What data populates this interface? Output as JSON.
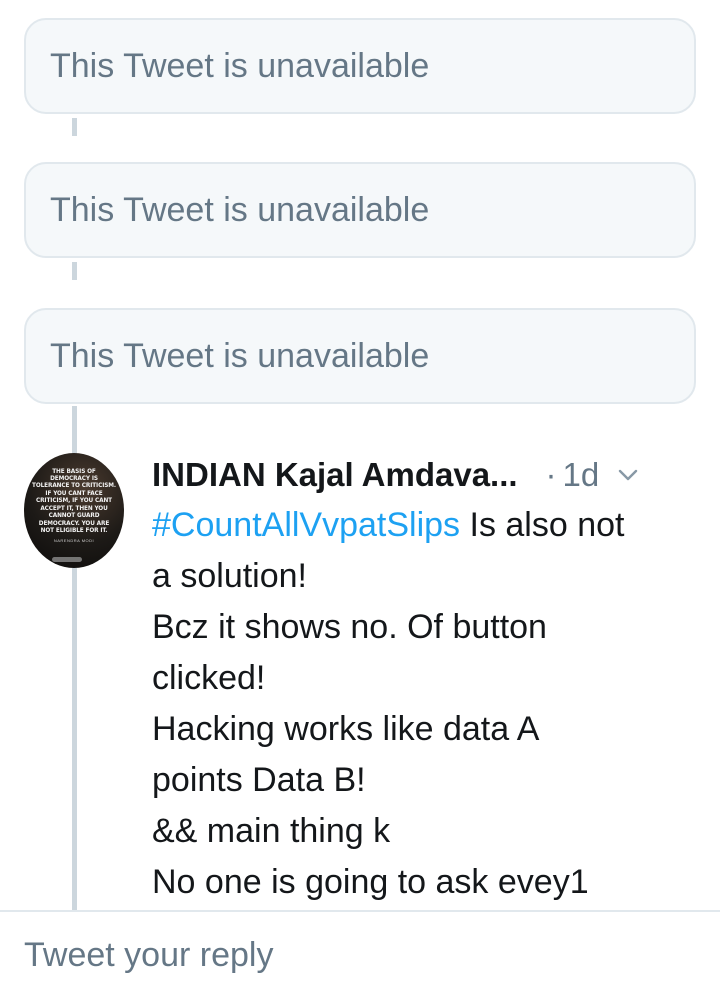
{
  "thread": {
    "unavailable_cards": [
      {
        "text": "This Tweet is unavailable"
      },
      {
        "text": "This Tweet is unavailable"
      },
      {
        "text": "This Tweet is unavailable"
      }
    ]
  },
  "tweet": {
    "author_name": "INDIAN Kajal Amdava...",
    "separator": "·",
    "time_ago": "1d",
    "avatar": {
      "quote": "THE BASIS OF DEMOCRACY IS TOLERANCE TO CRITICISM. IF YOU CANT FACE CRITICISM, IF YOU CANT ACCEPT IT, THEN YOU CANNOT GUARD DEMOCRACY. YOU ARE NOT ELIGIBLE FOR IT.",
      "author": "NARENDRA MODI"
    },
    "body": {
      "hashtag": "#CountAllVvpatSlips",
      "line1_rest": " Is also not",
      "line2": "a solution!",
      "line3": "Bcz it shows no. Of button",
      "line4": "clicked!",
      "line5": "Hacking works like data A",
      "line6": "points Data B!",
      "line7": "&& main thing k",
      "line8": "No one is going to ask evey1"
    },
    "menu_icon": "chevron-down-icon"
  },
  "composer": {
    "placeholder": "Tweet your reply"
  },
  "colors": {
    "link": "#1da1f2",
    "secondary_text": "#657786",
    "border": "#e1e8ed",
    "thread_line": "#ccd6dd",
    "card_bg": "#f5f8fa"
  }
}
